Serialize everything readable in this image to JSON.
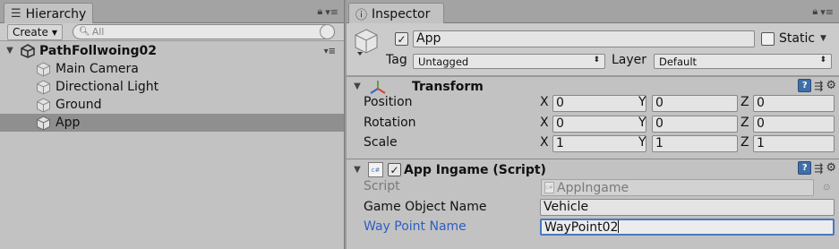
{
  "hierarchy": {
    "tab_label": "Hierarchy",
    "tab_icon": "list-icon",
    "create_label": "Create",
    "search_placeholder": "All",
    "scene": {
      "name": "PathFollwoing02"
    },
    "items": [
      {
        "label": "Main Camera",
        "selected": false
      },
      {
        "label": "Directional Light",
        "selected": false
      },
      {
        "label": "Ground",
        "selected": false
      },
      {
        "label": "App",
        "selected": true
      }
    ]
  },
  "inspector": {
    "tab_label": "Inspector",
    "tab_icon": "info-icon",
    "object": {
      "active": true,
      "name": "App",
      "static_label": "Static",
      "static_checked": false,
      "tag_label": "Tag",
      "tag_value": "Untagged",
      "layer_label": "Layer",
      "layer_value": "Default"
    },
    "transform": {
      "title": "Transform",
      "rows": [
        {
          "label": "Position",
          "x": "0",
          "y": "0",
          "z": "0"
        },
        {
          "label": "Rotation",
          "x": "0",
          "y": "0",
          "z": "0"
        },
        {
          "label": "Scale",
          "x": "1",
          "y": "1",
          "z": "1"
        }
      ],
      "axis_labels": {
        "x": "X",
        "y": "Y",
        "z": "Z"
      }
    },
    "script_component": {
      "title": "App Ingame (Script)",
      "enabled": true,
      "fields": {
        "script_label": "Script",
        "script_value": "AppIngame",
        "game_object_name_label": "Game Object Name",
        "game_object_name_value": "Vehicle",
        "way_point_name_label": "Way Point Name",
        "way_point_name_value": "WayPoint02"
      }
    }
  },
  "colors": {
    "panel_bg": "#c2c2c2",
    "selection": "#8f8f8f",
    "focus_border": "#4a78c2",
    "focused_label": "#2e5ec2",
    "help_icon": "#3f6fa8"
  }
}
